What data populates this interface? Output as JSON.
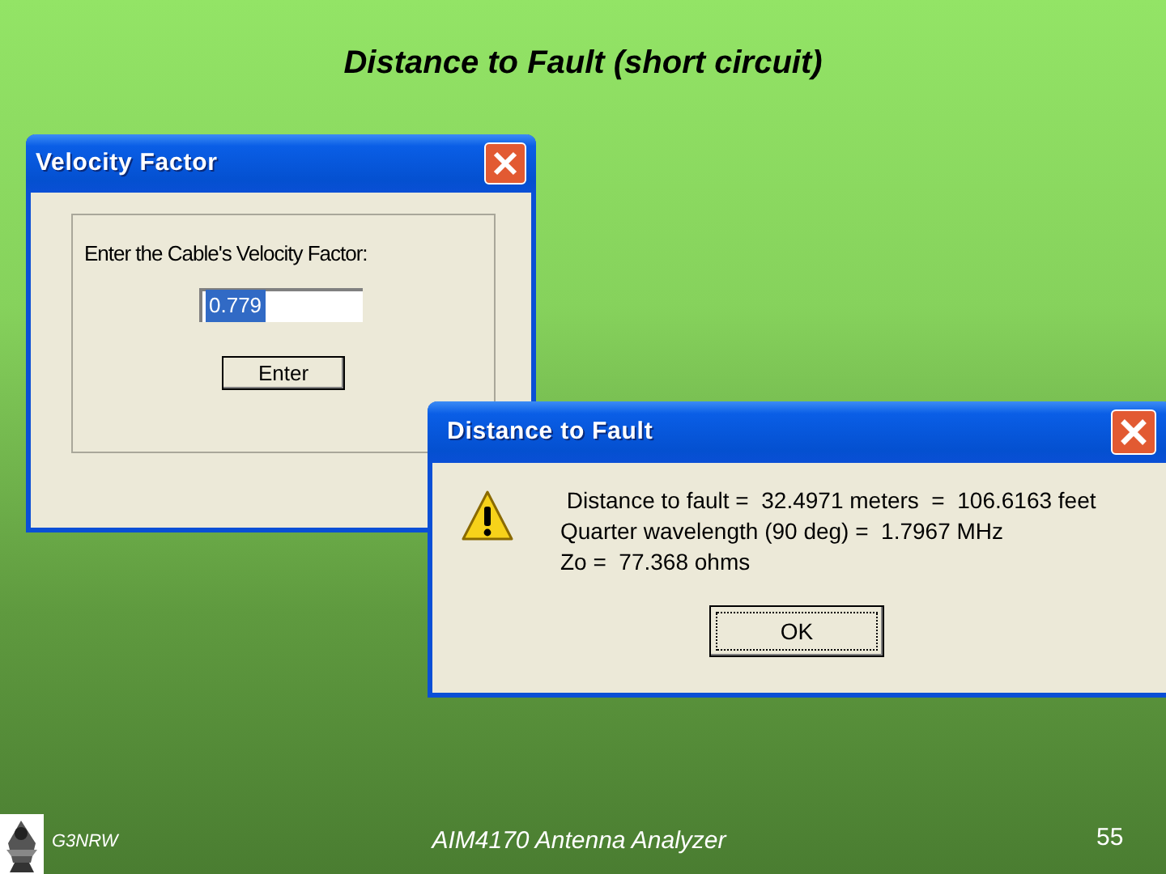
{
  "slide_title": "Distance to Fault (short circuit)",
  "velocity_dialog": {
    "title": "Velocity Factor",
    "prompt": "Enter the Cable's Velocity Factor:",
    "field": {
      "value": "0.779",
      "selected": true
    },
    "button": "Enter"
  },
  "fault_dialog": {
    "title": "Distance to Fault",
    "lines": [
      " Distance to fault =  32.4971 meters  =  106.6163 feet",
      "Quarter wavelength (90 deg) =  1.7967 MHz",
      "Zo =  77.368 ohms"
    ],
    "button": {
      "label": "OK",
      "focused": true
    }
  },
  "footer": {
    "author": "G3NRW",
    "center": "AIM4170 Antenna Analyzer",
    "page": "55"
  }
}
